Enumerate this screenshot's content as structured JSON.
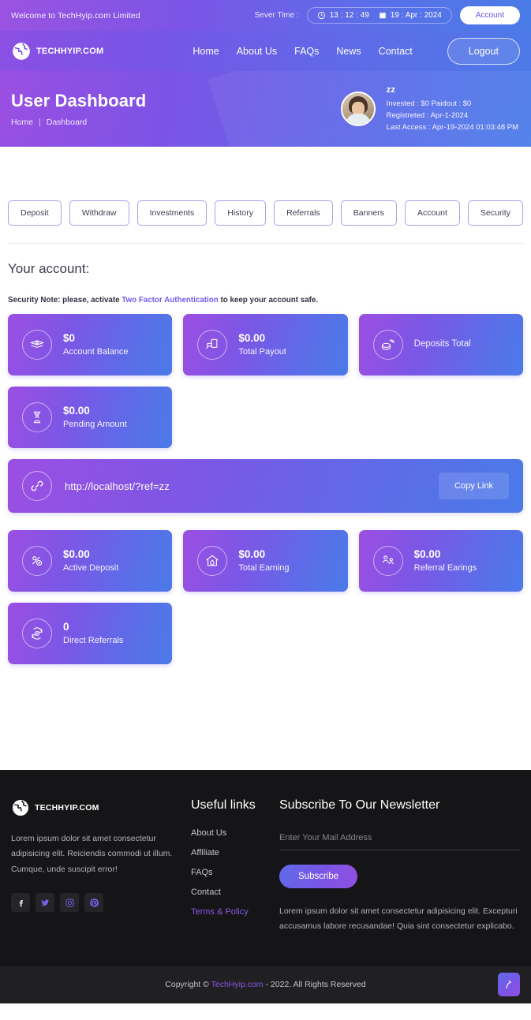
{
  "topbar": {
    "welcome": "Welcome to TechHyip.com Limited",
    "sever_time_label": "Sever Time :",
    "clock_icon": "clock-icon",
    "time": "13 : 12 : 49",
    "calendar_icon": "calendar-icon",
    "date": "19 : Apr : 2024",
    "account_label": "Account"
  },
  "nav": {
    "brand": "TECHHYIP.COM",
    "brand_icon": "globe-logo-icon",
    "links": [
      {
        "label": "Home"
      },
      {
        "label": "About Us"
      },
      {
        "label": "FAQs"
      },
      {
        "label": "News"
      },
      {
        "label": "Contact"
      }
    ],
    "logout_label": "Logout"
  },
  "hero": {
    "title": "User Dashboard",
    "breadcrumb_home": "Home",
    "breadcrumb_sep": "|",
    "breadcrumb_current": "Dashboard",
    "user": {
      "name": "zz",
      "avatar_icon": "user-avatar",
      "line1": "Invested  :  $0    Paidout  :  $0",
      "line2": "Registreted  :  Apr-1-2024",
      "line3": "Last Access  :  Apr-19-2024 01:03:48 PM"
    }
  },
  "tabs": [
    {
      "label": "Deposit"
    },
    {
      "label": "Withdraw"
    },
    {
      "label": "Investments"
    },
    {
      "label": "History"
    },
    {
      "label": "Referrals"
    },
    {
      "label": "Banners"
    },
    {
      "label": "Account"
    },
    {
      "label": "Security"
    }
  ],
  "account_section": {
    "title": "Your account:",
    "note_prefix": "Security Note: please, activate ",
    "note_link": "Two Factor Authentication",
    "note_suffix": " to keep your account safe."
  },
  "stats_row1": [
    {
      "value": "$0",
      "label": "Account Balance",
      "icon": "money-bills-icon"
    },
    {
      "value": "$0.00",
      "label": "Total Payout",
      "icon": "hand-cash-icon"
    },
    {
      "value": "",
      "label": "Deposits Total",
      "icon": "deposit-coins-icon"
    }
  ],
  "stats_row2": [
    {
      "value": "$0.00",
      "label": "Pending Amount",
      "icon": "hourglass-icon"
    }
  ],
  "referral": {
    "icon": "link-icon",
    "url": "http://localhost/?ref=zz",
    "copy_label": "Copy Link"
  },
  "stats_row3": [
    {
      "value": "$0.00",
      "label": "Active Deposit",
      "icon": "percent-dollar-icon"
    },
    {
      "value": "$0.00",
      "label": "Total Earning",
      "icon": "house-money-icon"
    },
    {
      "value": "$0.00",
      "label": "Referral Earings",
      "icon": "referral-people-icon"
    }
  ],
  "stats_row4": [
    {
      "value": "0",
      "label": "Direct Referrals",
      "icon": "refresh-dollar-icon"
    }
  ],
  "footer": {
    "brand": "TECHHYIP.COM",
    "brand_icon": "globe-logo-icon",
    "about": "Lorem ipsum dolor sit amet consectetur adipisicing elit. Reiciendis commodi ut illum. Cumque, unde suscipit error!",
    "socials": [
      {
        "name": "facebook-icon",
        "glyph": "f"
      },
      {
        "name": "twitter-icon",
        "glyph": "t"
      },
      {
        "name": "instagram-icon",
        "glyph": "i"
      },
      {
        "name": "pinterest-icon",
        "glyph": "P"
      }
    ],
    "links_title": "Useful links",
    "links": [
      {
        "label": "About Us",
        "accent": false
      },
      {
        "label": "Affiliate",
        "accent": false
      },
      {
        "label": "FAQs",
        "accent": false
      },
      {
        "label": "Contact",
        "accent": false
      },
      {
        "label": "Terms & Policy",
        "accent": true
      }
    ],
    "newsletter_title": "Subscribe To Our Newsletter",
    "newsletter_placeholder": "Enter Your Mail Address",
    "newsletter_value": "",
    "subscribe_label": "Subscribe",
    "newsletter_note": "Lorem ipsum dolor sit amet consectetur adipisicing elit. Excepturi accusamus labore recusandae! Quia sint consectetur explicabo."
  },
  "copybar": {
    "prefix": "Copyright © ",
    "brand_link": "TechHyip.com",
    "suffix": " - 2022. All Rights Reserved",
    "to_top_icon": "scroll-to-top-icon"
  },
  "colors": {
    "gradient_start": "#9b4fe2",
    "gradient_mid": "#7b57e6",
    "gradient_end": "#4b7ae9",
    "accent_link": "#6f5cf0",
    "footer_bg": "#151517",
    "copybar_bg": "#202022",
    "tab_border": "#a9a2e8"
  }
}
